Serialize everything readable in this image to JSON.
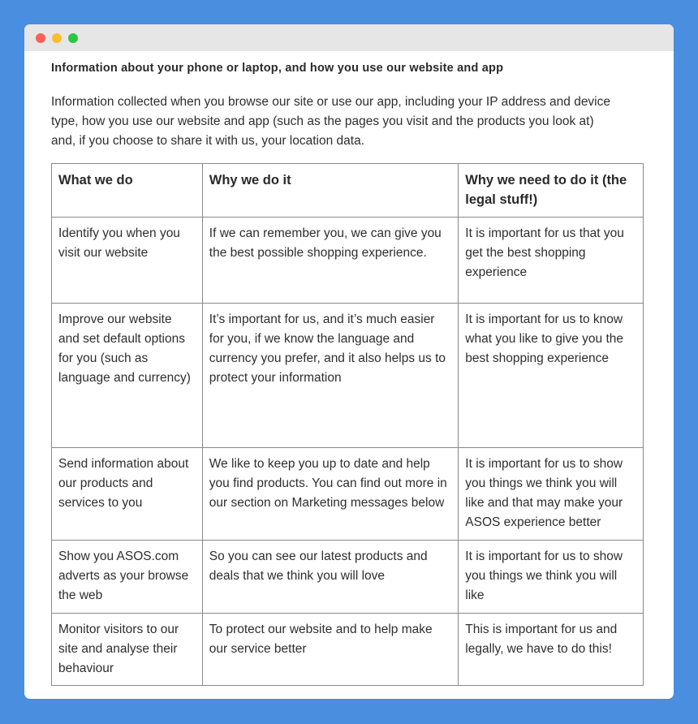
{
  "window": {
    "controls": [
      {
        "name": "close",
        "color": "#fe5f57"
      },
      {
        "name": "minimize",
        "color": "#febc2e"
      },
      {
        "name": "maximize",
        "color": "#28c840"
      }
    ]
  },
  "section": {
    "heading": "Information about your phone or laptop, and how you use our website and app",
    "intro": "Information collected when you browse our site or use our app, including your IP address and device type, how you use our website and app (such as the pages you visit and the products you look at) and, if you choose to share it with us, your location data."
  },
  "table": {
    "headers": [
      "What we do",
      "Why we do it",
      "Why we need to do it (the legal stuff!)"
    ],
    "rows": [
      [
        "Identify you when you visit our website",
        "If we can remember you, we can give you the best possible shopping experience.",
        "It is important for us that you get the best shopping experience"
      ],
      [
        "Improve our website and set default options for you (such as language and currency)",
        "It’s important for us, and it’s much easier for you, if we know the language and currency you prefer, and it also helps us to protect your information",
        "It is important for us to know what you like to give you the best shopping experience"
      ],
      [
        "Send information about our products and services to you",
        "We like to keep you up to date and help you find products. You can find out more in our section on Marketing messages below",
        "It is important for us to show you things we think you will like and that may make your ASOS experience better"
      ],
      [
        "Show you ASOS.com adverts as your browse the web",
        "So you can see our latest products and deals that we think you will love",
        "It is important for us to show you things we think you will like"
      ],
      [
        "Monitor visitors to our site and analyse their behaviour",
        "To protect our website and to help make our service better",
        "This is important for us and legally, we have to do this!"
      ]
    ]
  }
}
